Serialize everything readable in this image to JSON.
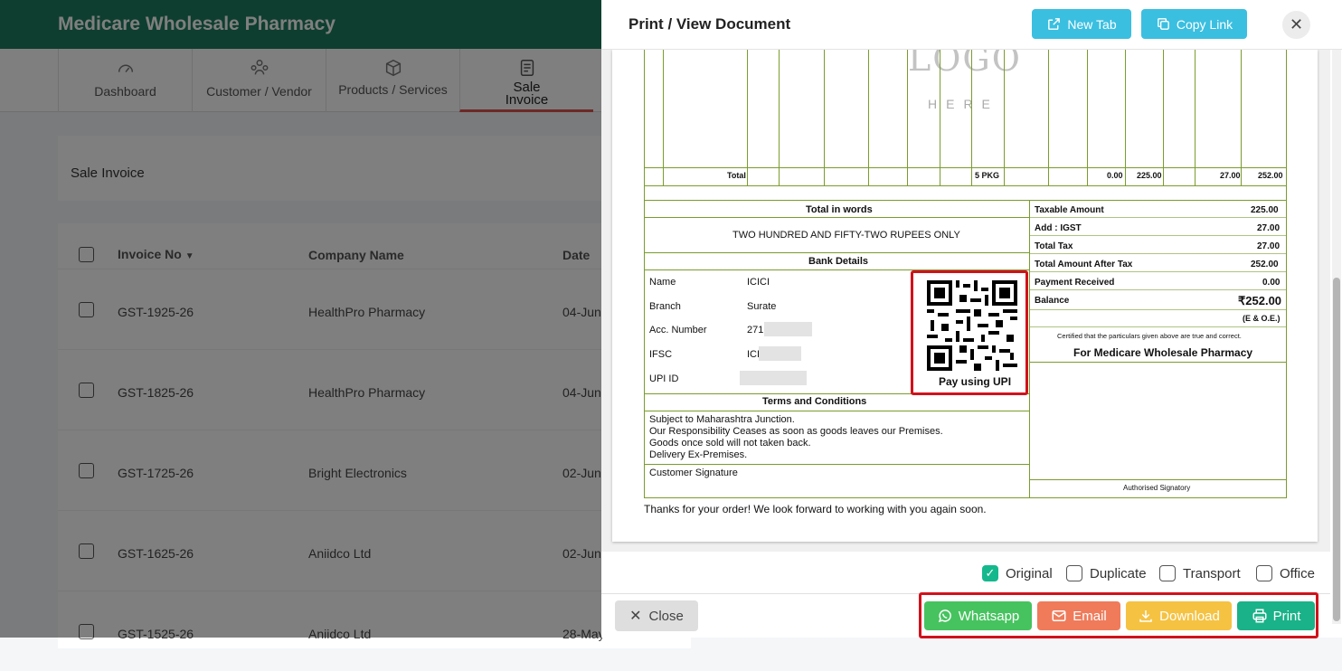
{
  "app": {
    "title": "Medicare Wholesale Pharmacy"
  },
  "nav": [
    {
      "label": "Dashboard",
      "icon": "gauge-icon"
    },
    {
      "label": "Customer / Vendor",
      "icon": "people-icon"
    },
    {
      "label": "Products / Services",
      "icon": "box-icon"
    },
    {
      "label": "Sale\nInvoice",
      "icon": "invoice-icon"
    }
  ],
  "section": {
    "title": "Sale Invoice"
  },
  "table": {
    "headers": {
      "invoice_no": "Invoice No",
      "company": "Company Name",
      "date": "Date"
    },
    "rows": [
      {
        "invoice": "GST-1925-26",
        "company": "HealthPro Pharmacy",
        "date": "04-Jun-"
      },
      {
        "invoice": "GST-1825-26",
        "company": "HealthPro Pharmacy",
        "date": "04-Jun-"
      },
      {
        "invoice": "GST-1725-26",
        "company": "Bright Electronics",
        "date": "02-Jun-"
      },
      {
        "invoice": "GST-1625-26",
        "company": "Aniidco Ltd",
        "date": "02-Jun-"
      },
      {
        "invoice": "GST-1525-26",
        "company": "Aniidco Ltd",
        "date": "28-May"
      }
    ]
  },
  "modal": {
    "title": "Print / View Document",
    "new_tab": "New Tab",
    "copy_link": "Copy Link",
    "close_x": "✕"
  },
  "doc": {
    "logo": "LOGO",
    "logo_sub": "HERE",
    "total_row": {
      "label": "Total",
      "qty": "5 PKG",
      "disc": "0.00",
      "taxable": "225.00",
      "tax": "27.00",
      "amount": "252.00"
    },
    "words_title": "Total in words",
    "words": "TWO HUNDRED AND FIFTY-TWO RUPEES ONLY",
    "bank_title": "Bank Details",
    "bank": {
      "name_label": "Name",
      "name": "ICICI",
      "branch_label": "Branch",
      "branch": "Surate",
      "acc_label": "Acc. Number",
      "acc": "271",
      "ifsc_label": "IFSC",
      "ifsc": "ICI",
      "upi_label": "UPI ID"
    },
    "qr_caption": "Pay using UPI",
    "terms_title": "Terms and Conditions",
    "terms": [
      "Subject to Maharashtra Junction.",
      "Our Responsibility Ceases as soon as goods leaves our Premises.",
      "Goods once sold will not taken back.",
      "Delivery Ex-Premises."
    ],
    "customer_sig": "Customer Signature",
    "summary": [
      {
        "label": "Taxable Amount",
        "value": "225.00"
      },
      {
        "label": "Add : IGST",
        "value": "27.00"
      },
      {
        "label": "Total Tax",
        "value": "27.00"
      },
      {
        "label": "Total Amount After Tax",
        "value": "252.00"
      },
      {
        "label": "Payment Received",
        "value": "0.00"
      },
      {
        "label": "Balance",
        "value": "₹252.00"
      }
    ],
    "eoe": "(E & O.E.)",
    "certified": "Certified that the particulars given above are true and correct.",
    "for_company": "For Medicare Wholesale Pharmacy",
    "auth_sig": "Authorised Signatory",
    "thanks": "Thanks for your order! We look forward to working with you again soon."
  },
  "copies": [
    {
      "label": "Original",
      "checked": true
    },
    {
      "label": "Duplicate",
      "checked": false
    },
    {
      "label": "Transport",
      "checked": false
    },
    {
      "label": "Office",
      "checked": false
    }
  ],
  "footer": {
    "close": "Close",
    "whatsapp": "Whatsapp",
    "email": "Email",
    "download": "Download",
    "print": "Print"
  },
  "colors": {
    "brand": "#1d7d5f",
    "whatsapp": "#46c35f",
    "email": "#ef7b5b",
    "download": "#f5c242",
    "print": "#1ab288",
    "info": "#3bbfe0",
    "highlight": "#d1121b"
  }
}
